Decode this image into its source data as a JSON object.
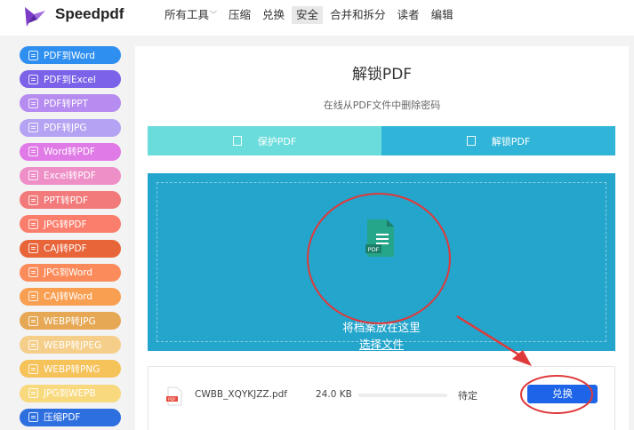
{
  "header": {
    "brand": "Speedpdf",
    "nav": [
      {
        "label": "所有工具",
        "has_caret": true
      },
      {
        "label": "压缩"
      },
      {
        "label": "兑换"
      },
      {
        "label": "安全",
        "active": true
      },
      {
        "label": "合并和拆分"
      },
      {
        "label": "读者"
      },
      {
        "label": "编辑"
      }
    ]
  },
  "sidebar": {
    "items": [
      {
        "label": "PDF到Word",
        "color": "#2f8ff0"
      },
      {
        "label": "PDF到Excel",
        "color": "#7b62e8"
      },
      {
        "label": "PDF转PPT",
        "color": "#b68cf0"
      },
      {
        "label": "PDF转JPG",
        "color": "#b5a2f2"
      },
      {
        "label": "Word转PDF",
        "color": "#e07ae6"
      },
      {
        "label": "Excel转PDF",
        "color": "#ee8fc7"
      },
      {
        "label": "PPT转PDF",
        "color": "#f27a7a"
      },
      {
        "label": "JPG转PDF",
        "color": "#fb7d6b"
      },
      {
        "label": "CAJ转PDF",
        "color": "#e8653a"
      },
      {
        "label": "JPG到Word",
        "color": "#fb8b5a"
      },
      {
        "label": "CAJ转Word",
        "color": "#f99f52"
      },
      {
        "label": "WEBP转JPG",
        "color": "#e6a855"
      },
      {
        "label": "WEBP转JPEG",
        "color": "#f5cf8a"
      },
      {
        "label": "WEBP转PNG",
        "color": "#f6c25a"
      },
      {
        "label": "JPG到WEPB",
        "color": "#f8d97e"
      },
      {
        "label": "压缩PDF",
        "color": "#2e6fe0"
      }
    ]
  },
  "main": {
    "title": "解锁PDF",
    "subtitle": "在线从PDF文件中删除密码",
    "tabs": [
      {
        "label": "保护PDF",
        "color": "#6bdcdc"
      },
      {
        "label": "解锁PDF",
        "color": "#30b5d8",
        "active": true
      }
    ],
    "dropzone": {
      "text": "将档案放在这里",
      "link": "选择文件",
      "icon_badge": "PDF",
      "color": "#23a5cc"
    },
    "file": {
      "name": "CWBB_XQYKJZZ.pdf",
      "size": "24.0 KB",
      "status": "待定",
      "progress": 0,
      "action_label": "兑换",
      "icon_badge": "PDF"
    }
  },
  "colors": {
    "annotation": "#e0393a",
    "primary_button": "#1e64e8"
  }
}
